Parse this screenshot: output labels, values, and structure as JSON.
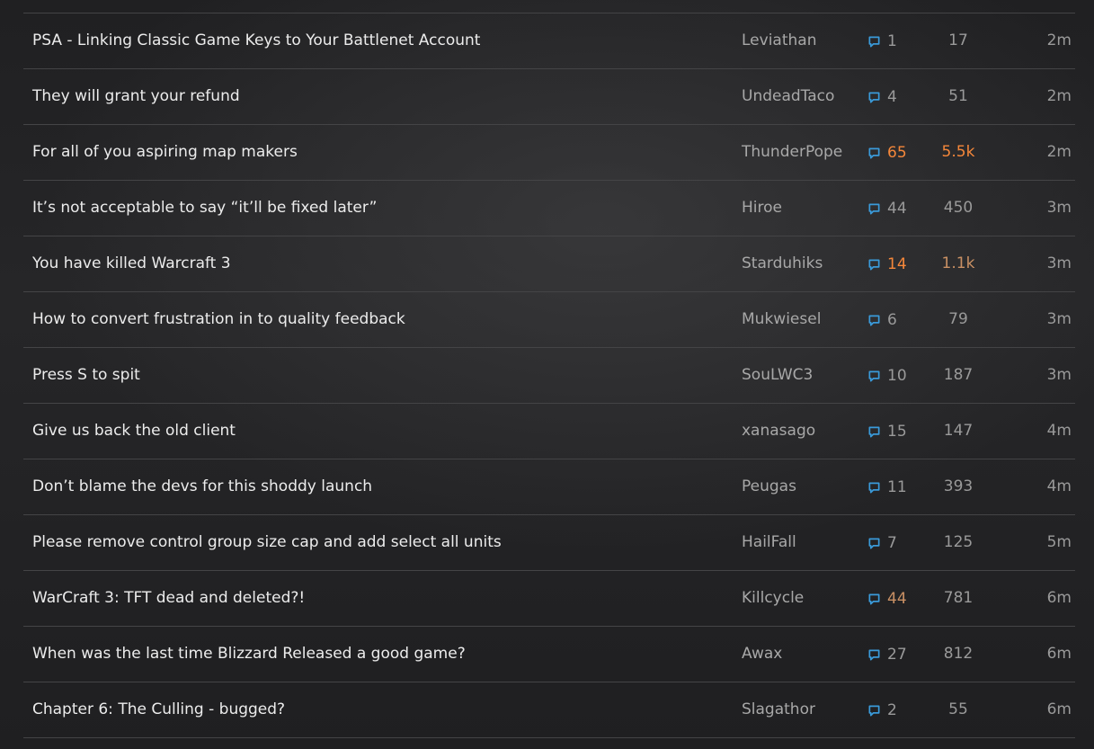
{
  "colors": {
    "reply_icon": "#3a9ad9",
    "hot": "#f5873a",
    "warm": "#c99064",
    "muted": "#9a9a9a"
  },
  "icons": {
    "reply": "speech-bubble-icon"
  },
  "topics": [
    {
      "title": "PSA - Linking Classic Game Keys to Your Battlenet Account",
      "author": "Leviathan",
      "replies": "1",
      "views": "17",
      "activity": "2m",
      "replies_heat": "",
      "views_heat": ""
    },
    {
      "title": "They will grant your refund",
      "author": "UndeadTaco",
      "replies": "4",
      "views": "51",
      "activity": "2m",
      "replies_heat": "",
      "views_heat": ""
    },
    {
      "title": "For all of you aspiring map makers",
      "author": "ThunderPope",
      "replies": "65",
      "views": "5.5k",
      "activity": "2m",
      "replies_heat": "hot",
      "views_heat": "hot"
    },
    {
      "title": "It’s not acceptable to say “it’ll be fixed later”",
      "author": "Hiroe",
      "replies": "44",
      "views": "450",
      "activity": "3m",
      "replies_heat": "",
      "views_heat": ""
    },
    {
      "title": "You have killed Warcraft 3",
      "author": "Starduhiks",
      "replies": "14",
      "views": "1.1k",
      "activity": "3m",
      "replies_heat": "hot",
      "views_heat": "warm"
    },
    {
      "title": "How to convert frustration in to quality feedback",
      "author": "Mukwiesel",
      "replies": "6",
      "views": "79",
      "activity": "3m",
      "replies_heat": "",
      "views_heat": ""
    },
    {
      "title": "Press S to spit",
      "author": "SouLWC3",
      "replies": "10",
      "views": "187",
      "activity": "3m",
      "replies_heat": "",
      "views_heat": ""
    },
    {
      "title": "Give us back the old client",
      "author": "xanasago",
      "replies": "15",
      "views": "147",
      "activity": "4m",
      "replies_heat": "",
      "views_heat": ""
    },
    {
      "title": "Don’t blame the devs for this shoddy launch",
      "author": "Peugas",
      "replies": "11",
      "views": "393",
      "activity": "4m",
      "replies_heat": "",
      "views_heat": ""
    },
    {
      "title": "Please remove control group size cap and add select all units",
      "author": "HailFall",
      "replies": "7",
      "views": "125",
      "activity": "5m",
      "replies_heat": "",
      "views_heat": ""
    },
    {
      "title": "WarCraft 3: TFT dead and deleted?!",
      "author": "Killcycle",
      "replies": "44",
      "views": "781",
      "activity": "6m",
      "replies_heat": "warm",
      "views_heat": ""
    },
    {
      "title": "When was the last time Blizzard Released a good game?",
      "author": "Awax",
      "replies": "27",
      "views": "812",
      "activity": "6m",
      "replies_heat": "",
      "views_heat": ""
    },
    {
      "title": "Chapter 6: The Culling - bugged?",
      "author": "Slagathor",
      "replies": "2",
      "views": "55",
      "activity": "6m",
      "replies_heat": "",
      "views_heat": ""
    }
  ]
}
